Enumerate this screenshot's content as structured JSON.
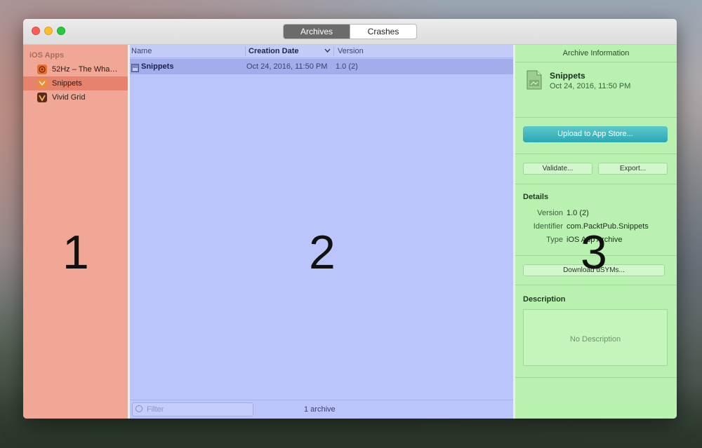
{
  "window": {
    "tabs": [
      {
        "label": "Archives",
        "active": true
      },
      {
        "label": "Crashes",
        "active": false
      }
    ]
  },
  "sidebar": {
    "header": "iOS Apps",
    "items": [
      {
        "label": "52Hz – The Wha…",
        "icon": "app-52hz-icon",
        "selected": false
      },
      {
        "label": "Snippets",
        "icon": "app-snippets-icon",
        "selected": true
      },
      {
        "label": "Vivid Grid",
        "icon": "app-vividgrid-icon",
        "selected": false
      }
    ],
    "overlay_number": "1"
  },
  "main": {
    "columns": [
      "Name",
      "Creation Date",
      "Version"
    ],
    "rows": [
      {
        "name": "Snippets",
        "date": "Oct 24, 2016, 11:50 PM",
        "version": "1.0 (2)"
      }
    ],
    "filter_placeholder": "Filter",
    "archive_count": "1 archive",
    "overlay_number": "2"
  },
  "inspector": {
    "title": "Archive Information",
    "archive_name": "Snippets",
    "archive_date": "Oct 24, 2016, 11:50 PM",
    "upload_label": "Upload to App Store...",
    "validate_label": "Validate...",
    "export_label": "Export...",
    "details_title": "Details",
    "details": [
      {
        "label": "Version",
        "value": "1.0 (2)"
      },
      {
        "label": "Identifier",
        "value": "com.PacktPub.Snippets"
      },
      {
        "label": "Type",
        "value": "iOS App Archive"
      }
    ],
    "download_dsyms_label": "Download dSYMs...",
    "description_title": "Description",
    "description_placeholder": "No Description",
    "overlay_number": "3"
  },
  "colors": {
    "panel1": "#f1a796",
    "panel2": "#bbc5fb",
    "panel3": "#b9f1b0",
    "upload_button": "#2ba8b5"
  }
}
